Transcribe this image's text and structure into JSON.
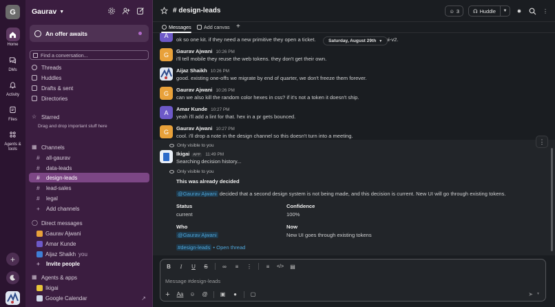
{
  "workspace": {
    "initial": "G",
    "name": "Gaurav"
  },
  "rail": [
    {
      "label": "Home",
      "icon": "home-icon"
    },
    {
      "label": "DMs",
      "icon": "dm-icon"
    },
    {
      "label": "Activity",
      "icon": "bell-icon"
    },
    {
      "label": "Files",
      "icon": "files-icon"
    },
    {
      "label": "Agents & tools",
      "icon": "agents-icon"
    }
  ],
  "sidebar": {
    "offer": "An offer awaits",
    "find_placeholder": "Find a conversation...",
    "nav": [
      "Threads",
      "Huddles",
      "Drafts & sent",
      "Directories"
    ],
    "starred": "Starred",
    "starred_hint": "Drag and drop important stuff here",
    "channels_header": "Channels",
    "channels": [
      "all-gaurav",
      "data-leads",
      "design-leads",
      "lead-sales",
      "legal"
    ],
    "add_channels": "Add channels",
    "dm_header": "Direct messages",
    "dms": [
      {
        "name": "Gaurav Ajwani",
        "color": "#e8a13a"
      },
      {
        "name": "Amar Kunde",
        "color": "#6d59c8"
      },
      {
        "name": "Aijaz Shaikh",
        "color": "#3f7fd6",
        "you": "you"
      }
    ],
    "invite": "Invite people",
    "apps_header": "Agents & apps",
    "apps": [
      {
        "name": "Ikigai",
        "color": "#e8c53a"
      },
      {
        "name": "Google Calendar",
        "color": "#d0d8e8"
      }
    ]
  },
  "header": {
    "channel": "# design-leads",
    "member_count": "3",
    "huddle": "Huddle",
    "tabs": [
      "Messages",
      "Add canvas"
    ]
  },
  "messages": {
    "date_pill": "Saturday, August 29th",
    "partial": {
      "initial": "A",
      "text": "ok so one kit. if they need a new primitive they open a ticket.",
      "text_tail": "called ui-v2."
    },
    "list": [
      {
        "initial": "G",
        "name": "Gaurav Ajwani",
        "time": "10:26 PM",
        "text": "i'll tell mobile they reuse the web tokens. they don't get their own."
      },
      {
        "initial": "",
        "name": "Aijaz Shaikh",
        "time": "10:26 PM",
        "text": "good. existing one-offs we migrate by end of quarter, we don't freeze them forever."
      },
      {
        "initial": "G",
        "name": "Gaurav Ajwani",
        "time": "10:26 PM",
        "text": "can we also kill the random color hexes in css? if it's not a token it doesn't ship."
      },
      {
        "initial": "A",
        "name": "Amar Kunde",
        "time": "10:27 PM",
        "text": "yeah i'll add a lint for that. hex in a pr gets bounced."
      },
      {
        "initial": "G",
        "name": "Gaurav Ajwani",
        "time": "10:27 PM",
        "text": "cool. i'll drop a note in the design channel so this doesn't turn into a meeting."
      }
    ]
  },
  "bot": {
    "visible_only": "Only visible to you",
    "name": "Ikigai",
    "badge": "APP",
    "time": "11:49 PM",
    "status_text": "Searching decision history...",
    "visible_only_2": "Only visible to you",
    "heading": "This was already decided",
    "mention": "@Gaurav Ajwani",
    "decision_text": " decided that a second design system is not being made, and this decision is current. New UI will go through existing tokens.",
    "status_label": "Status",
    "status_value": "current",
    "confidence_label": "Confidence",
    "confidence_value": "100%",
    "who_label": "Who",
    "who_value": "@Gaurav Ajwani",
    "now_label": "Now",
    "now_value": "New UI goes through existing tokens",
    "channel_link": "#design-leads",
    "open_thread": " • Open thread"
  },
  "composer": {
    "placeholder": "Message #design-leads"
  }
}
